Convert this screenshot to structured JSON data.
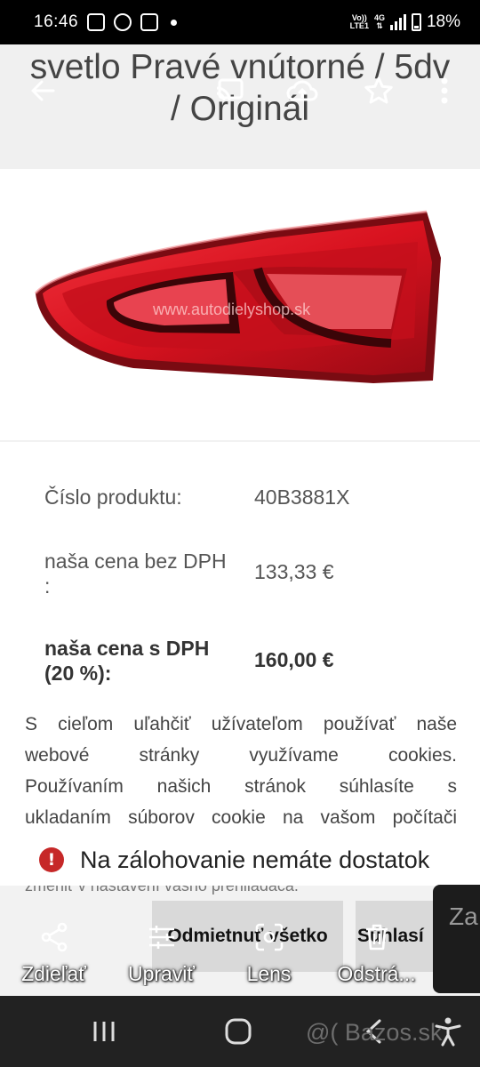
{
  "status_bar": {
    "time": "16:46",
    "network_top": "Vo))",
    "network_bottom": "LTE1",
    "network_type": "4G",
    "battery": "18%",
    "icons": [
      "facebook-icon",
      "messenger-icon",
      "shop-icon",
      "notification-dot"
    ]
  },
  "header": {
    "title": "svetlo Pravé vnútorné / 5dv / Originál",
    "icons": [
      "back-arrow-icon",
      "cast-icon",
      "cloud-upload-icon",
      "star-icon",
      "more-vert-icon"
    ]
  },
  "image": {
    "watermark": "www.autodielyshop.sk",
    "subject": "red tail light"
  },
  "details": {
    "rows": [
      {
        "label": "Číslo produktu:",
        "value": "40B3881X"
      },
      {
        "label": "naša cena bez DPH :",
        "value": "133,33 €"
      },
      {
        "label": "naša cena s DPH (20 %):",
        "value": "160,00 €"
      }
    ]
  },
  "cookie_notice": {
    "lines": [
      "S cieľom uľahčiť užívateľom používať naše",
      "webové stránky využívame cookies.",
      "Používaním našich stránok súhlasíte s",
      "ukladaním súborov cookie na vašom počítači"
    ],
    "partial_line": "zmeniť v nastavení vášho prehliadača.",
    "reject_label": "Odmietnuť všetko",
    "accept_label": "Súhlasí"
  },
  "snackbar": {
    "message": "Na zálohovanie nemáte dostatok"
  },
  "side_panel": {
    "text": "Za"
  },
  "toolbar": {
    "items": [
      {
        "label": "Zdieľať",
        "icon": "share-icon"
      },
      {
        "label": "Upraviť",
        "icon": "sliders-icon"
      },
      {
        "label": "Lens",
        "icon": "lens-icon"
      },
      {
        "label": "Odstrá...",
        "icon": "trash-icon"
      }
    ]
  },
  "nav_bar": {
    "watermark": "@( Bazos.sk",
    "buttons": [
      "recents-icon",
      "home-icon",
      "back-icon",
      "accessibility-icon"
    ]
  },
  "colors": {
    "tail_light_red": "#d8121f",
    "error_red": "#c62828",
    "nav_bg": "#222222"
  }
}
